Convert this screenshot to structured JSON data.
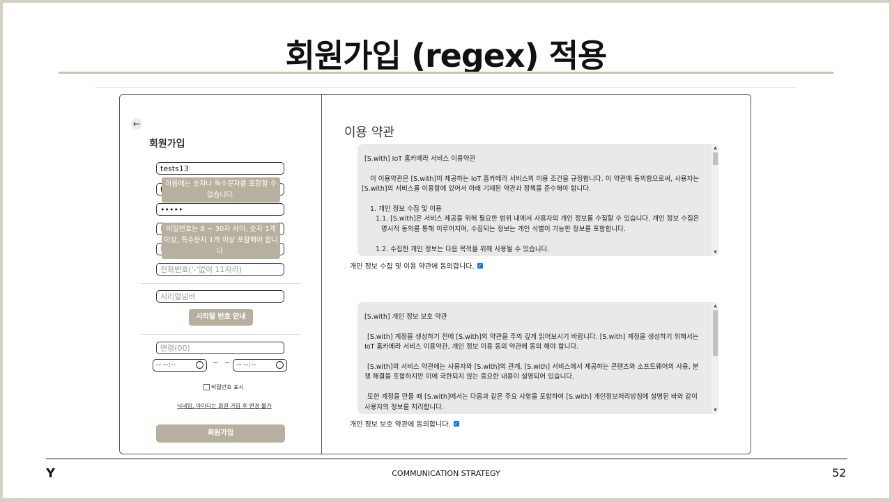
{
  "slide": {
    "title": "회원가입 (regex) 적용",
    "footer": "COMMUNICATION STRATEGY",
    "page_number": "52",
    "logo": "Y"
  },
  "signup": {
    "back_icon": "←",
    "title": "회원가입",
    "username_value": "tests13",
    "name_partial": "t",
    "name_tooltip": "이름에는 숫자나 특수문자를 포함할 수 없습니다.",
    "password_value": "•••••",
    "password_partial_1": "비",
    "password_partial_2": "비",
    "password_tooltip": "비밀번호는 8 ~ 30자 사이, 숫자 1개 이상, 특수문자 1개 이상 포함해야 합니다.",
    "phone_placeholder": "전화번호('-'없이 11자리)",
    "serial_placeholder": "시리얼넘버",
    "serial_button": "시리얼 번호 안내",
    "age_placeholder": "연령(00)",
    "time_start": "-- --:--",
    "time_end": "-- --:--",
    "tilde": "~",
    "show_password_label": "비밀번호 표시",
    "note": "닉네임, 아이디는 회원 가입 후 변경 불가",
    "submit_button": "회원가입"
  },
  "terms": {
    "title": "이용 약관",
    "box1": {
      "heading": "[S.with] IoT 홈카메라 서비스 이용약관",
      "p1": "이 이용약관은 [S.with]이 제공하는 IoT 홈카메라 서비스의 이용 조건을 규정합니다. 이 약관에 동의함으로써, 사용자는 [S.with]의 서비스를 이용함에 있어서 아래 기재된 약관과 정책을 준수해야 합니다.",
      "s1": "1. 개인 정보 수집 및 이용",
      "s11": "1.1. [S.with]은 서비스 제공을 위해 필요한 범위 내에서 사용자의 개인 정보를 수집할 수 있습니다. 개인 정보 수집은 명시적 동의를 통해 이루어지며, 수집되는 정보는 개인 식별이 가능한 정보를 포함합니다.",
      "s12": "1.2. 수집한 개인 정보는 다음 목적을 위해 사용될 수 있습니다."
    },
    "agree1": "개인 정보 수집 및 이용 약관에 동의합니다.",
    "box2": {
      "heading": "[S.with] 개인 정보 보호 약관",
      "p1": "[S.with] 계정을 생성하기 전에 [S.with]의 약관을 주의 깊게 읽어보시기 바랍니다. [S.with] 계정을 생성하기 위해서는 IoT 홈카메라 서비스 이용약관, 개인 정보 이용 동의 약관에 동의 해야 합니다.",
      "p2": "[S.with]의 서비스 약관에는 사용자와 [S.with]의 관계, [S.with] 서비스에서 제공하는 콘텐츠와 소프트웨어의 사용, 분쟁 해결을 포함하지만 이에 국한되지 않는 중요한 내용이 설명되어 있습니다.",
      "p3": "또한 계정을 만들 때 [S.with]에서는 다음과 같은 주요 사항을 포함하여 [S.with] 개인정보처리방침에 설명된 바와 같이 사용자의 정보를 처리합니다."
    },
    "agree2": "개인 정보 보호 약관에 동의합니다."
  }
}
